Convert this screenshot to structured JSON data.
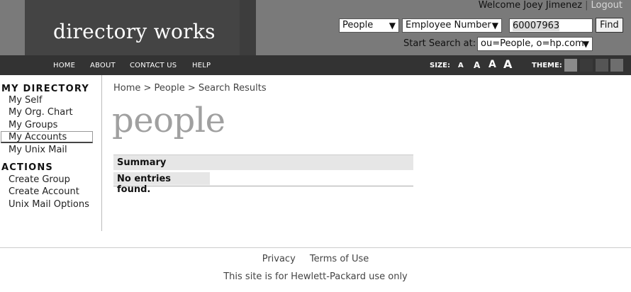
{
  "header": {
    "logo_text": "directory works",
    "welcome_text": "Welcome Joey Jimenez",
    "separator": "|",
    "logout_label": "Logout"
  },
  "search": {
    "type_value": "People",
    "attribute_value": "Employee Number",
    "query_value": "60007963",
    "find_label": "Find",
    "start_label": "Start Search at:",
    "base_value": "ou=People, o=hp.com"
  },
  "nav": {
    "items": [
      "HOME",
      "ABOUT",
      "CONTACT US",
      "HELP"
    ],
    "size_label": "SIZE:",
    "size_glyph": "A",
    "theme_label": "THEME:",
    "theme_colors": [
      "#8a8a8a",
      "#3a3a3a",
      "#555555",
      "#6e6e6e"
    ]
  },
  "sidebar": {
    "my_directory_heading": "MY DIRECTORY",
    "my_directory_items": [
      "My Self",
      "My Org. Chart",
      "My Groups",
      "My Accounts",
      "My Unix Mail"
    ],
    "actions_heading": "ACTIONS",
    "actions_items": [
      "Create Group",
      "Create Account",
      "Unix Mail Options"
    ]
  },
  "main": {
    "breadcrumb": "Home > People > Search Results",
    "page_title": "people",
    "summary_header": "Summary",
    "no_entries": "No entries found."
  },
  "footer": {
    "privacy_label": "Privacy",
    "terms_label": "Terms of Use",
    "note": "This site is for Hewlett-Packard use only"
  },
  "icons": {
    "dropdown": "chevron-down-icon"
  }
}
